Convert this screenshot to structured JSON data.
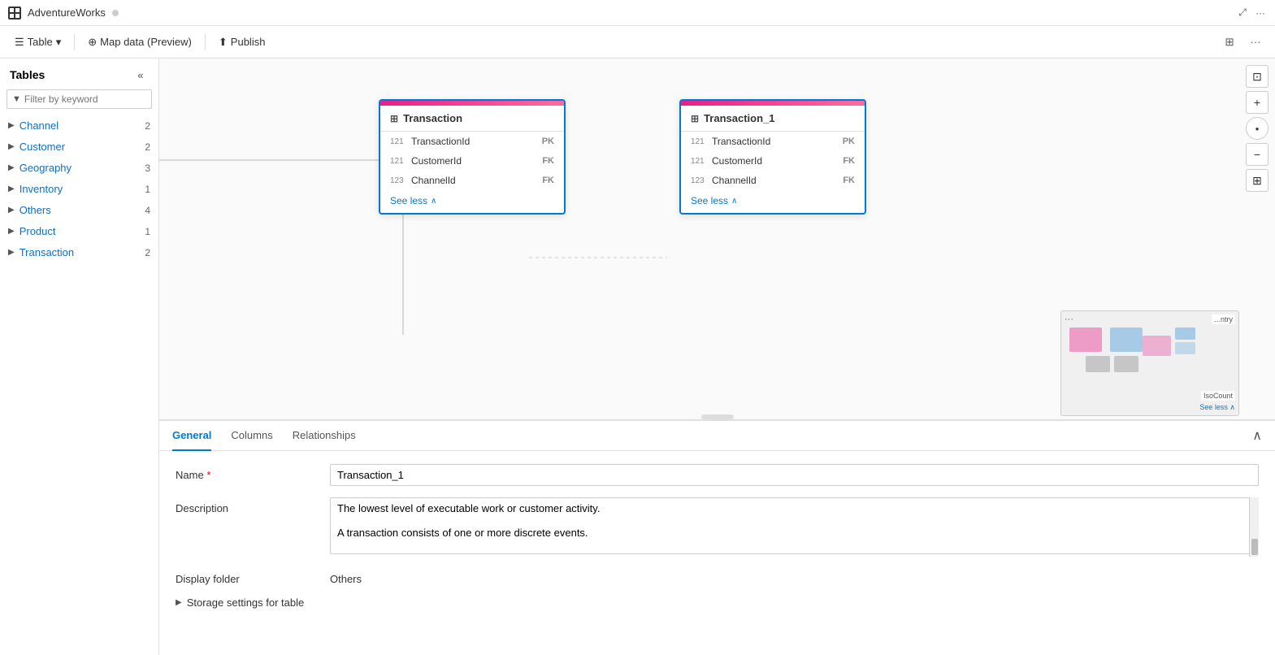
{
  "app": {
    "title": "AdventureWorks",
    "dot_color": "#aaa"
  },
  "toolbar": {
    "table_label": "Table",
    "map_data_label": "Map data (Preview)",
    "publish_label": "Publish"
  },
  "sidebar": {
    "title": "Tables",
    "filter_placeholder": "Filter by keyword",
    "items": [
      {
        "id": "channel",
        "label": "Channel",
        "count": "2"
      },
      {
        "id": "customer",
        "label": "Customer",
        "count": "2"
      },
      {
        "id": "geography",
        "label": "Geography",
        "count": "3"
      },
      {
        "id": "inventory",
        "label": "Inventory",
        "count": "1"
      },
      {
        "id": "others",
        "label": "Others",
        "count": "4"
      },
      {
        "id": "product",
        "label": "Product",
        "count": "1"
      },
      {
        "id": "transaction",
        "label": "Transaction",
        "count": "2"
      }
    ]
  },
  "transaction_card": {
    "title": "Transaction",
    "columns": [
      {
        "type": "121",
        "name": "TransactionId",
        "key": "PK"
      },
      {
        "type": "121",
        "name": "CustomerId",
        "key": "FK"
      },
      {
        "type": "123",
        "name": "ChannelId",
        "key": "FK"
      }
    ],
    "see_less_label": "See less"
  },
  "transaction1_card": {
    "title": "Transaction_1",
    "columns": [
      {
        "type": "121",
        "name": "TransactionId",
        "key": "PK"
      },
      {
        "type": "121",
        "name": "CustomerId",
        "key": "FK"
      },
      {
        "type": "123",
        "name": "ChannelId",
        "key": "FK"
      }
    ],
    "see_less_label": "See less"
  },
  "bottom_panel": {
    "tabs": [
      {
        "id": "general",
        "label": "General",
        "active": true
      },
      {
        "id": "columns",
        "label": "Columns",
        "active": false
      },
      {
        "id": "relationships",
        "label": "Relationships",
        "active": false
      }
    ],
    "form": {
      "name_label": "Name",
      "name_required": "*",
      "name_value": "Transaction_1",
      "description_label": "Description",
      "description_value": "The lowest level of executable work or customer activity.\n\nA transaction consists of one or more discrete events.",
      "display_folder_label": "Display folder",
      "display_folder_value": "Others",
      "storage_settings_label": "Storage settings for table"
    }
  },
  "zoom_controls": {
    "fit_icon": "⊡",
    "plus_icon": "+",
    "minus_icon": "−"
  }
}
